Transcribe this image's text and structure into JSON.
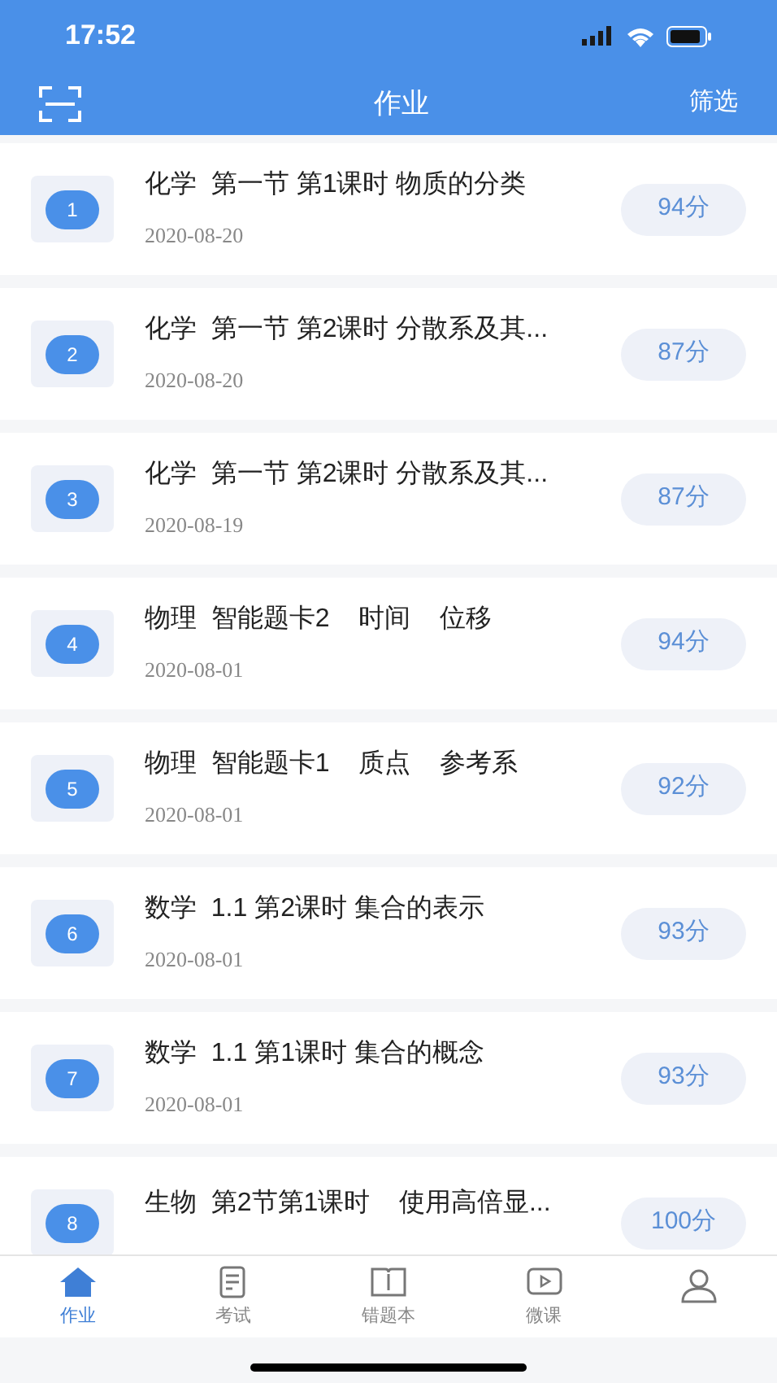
{
  "status_bar": {
    "time": "17:52"
  },
  "header": {
    "title": "作业",
    "action": "筛选"
  },
  "items": [
    {
      "number": "1",
      "title": "化学  第一节 第1课时 物质的分类",
      "date": "2020-08-20",
      "score": "94分"
    },
    {
      "number": "2",
      "title": "化学  第一节 第2课时 分散系及其...",
      "date": "2020-08-20",
      "score": "87分"
    },
    {
      "number": "3",
      "title": "化学  第一节 第2课时 分散系及其...",
      "date": "2020-08-19",
      "score": "87分"
    },
    {
      "number": "4",
      "title": "物理  智能题卡2    时间    位移",
      "date": "2020-08-01",
      "score": "94分"
    },
    {
      "number": "5",
      "title": "物理  智能题卡1    质点    参考系",
      "date": "2020-08-01",
      "score": "92分"
    },
    {
      "number": "6",
      "title": "数学  1.1 第2课时 集合的表示",
      "date": "2020-08-01",
      "score": "93分"
    },
    {
      "number": "7",
      "title": "数学  1.1 第1课时 集合的概念",
      "date": "2020-08-01",
      "score": "93分"
    },
    {
      "number": "8",
      "title": "生物  第2节第1课时    使用高倍显...",
      "score": "100分"
    }
  ],
  "tabs": [
    {
      "kind": "home",
      "label": "作业",
      "selected": true
    },
    {
      "kind": "exam",
      "label": "考试",
      "selected": false
    },
    {
      "kind": "book",
      "label": "错题本",
      "selected": false
    },
    {
      "kind": "video",
      "label": "微课",
      "selected": false
    },
    {
      "kind": "user",
      "selected": false
    }
  ]
}
